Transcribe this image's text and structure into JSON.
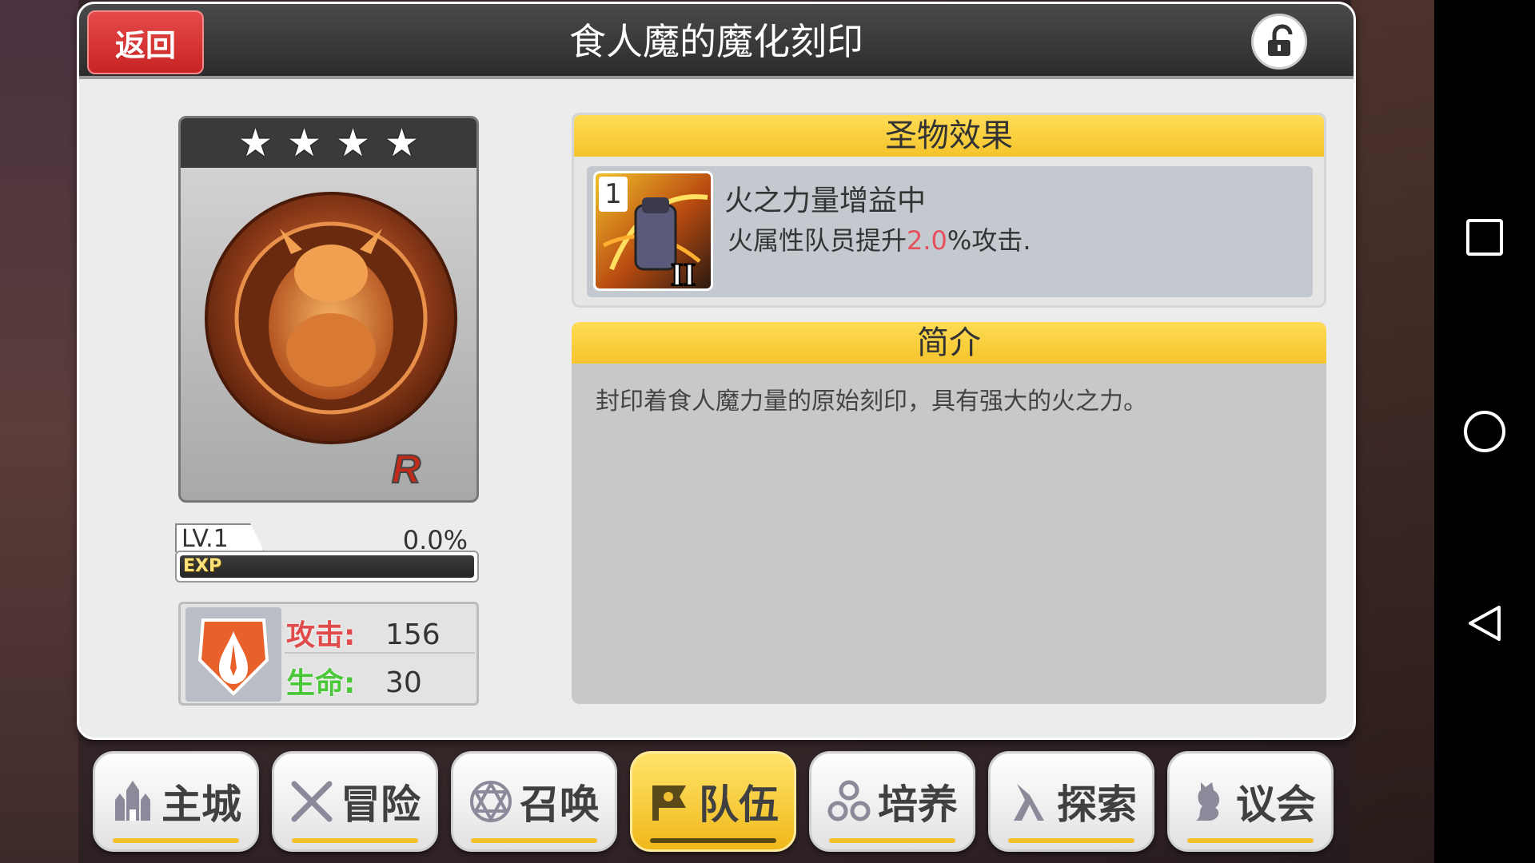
{
  "header": {
    "back_label": "返回",
    "title": "食人魔的魔化刻印"
  },
  "relic": {
    "stars": 4,
    "rarity": "R",
    "level": "LV.1",
    "exp_percent": "0.0%",
    "exp_fraction": 0.0,
    "exp_label": "EXP"
  },
  "stats": {
    "attack_label": "攻击:",
    "attack_value": "156",
    "hp_label": "生命:",
    "hp_value": "30"
  },
  "effect": {
    "header": "圣物效果",
    "skill_number": "1",
    "title": "火之力量增益中",
    "desc_prefix": "火属性队员提升",
    "desc_value": "2.0",
    "desc_suffix": "%攻击."
  },
  "intro": {
    "header": "简介",
    "text": "封印着食人魔力量的原始刻印，具有强大的火之力。"
  },
  "menu": {
    "items": [
      {
        "label": "主城",
        "icon": "castle-icon"
      },
      {
        "label": "冒险",
        "icon": "crossed-swords-icon"
      },
      {
        "label": "召唤",
        "icon": "hexagram-icon"
      },
      {
        "label": "队伍",
        "icon": "team-banner-icon"
      },
      {
        "label": "培养",
        "icon": "triple-circle-icon"
      },
      {
        "label": "探索",
        "icon": "explore-icon"
      },
      {
        "label": "议会",
        "icon": "council-crest-icon"
      }
    ],
    "active_index": 3
  },
  "colors": {
    "back_button": "#d83232",
    "section_header": "#f8cf3c",
    "highlight_value": "#e6505a",
    "attack_label": "#e04a4a",
    "hp_label": "#4ac83a"
  }
}
